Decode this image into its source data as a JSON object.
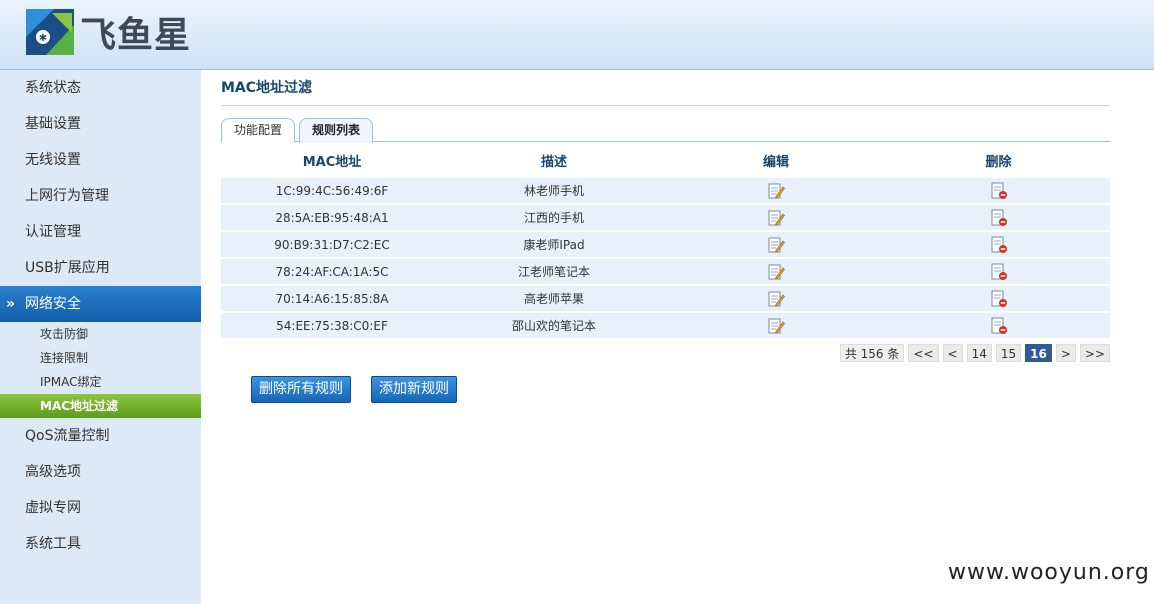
{
  "logo": {
    "text": "飞鱼星"
  },
  "sidebar": {
    "items": [
      {
        "label": "系统状态"
      },
      {
        "label": "基础设置"
      },
      {
        "label": "无线设置"
      },
      {
        "label": "上网行为管理"
      },
      {
        "label": "认证管理"
      },
      {
        "label": "USB扩展应用"
      },
      {
        "label": "网络安全",
        "expanded": true
      },
      {
        "label": "QoS流量控制"
      },
      {
        "label": "高级选项"
      },
      {
        "label": "虚拟专网"
      },
      {
        "label": "系统工具"
      }
    ],
    "subitems": [
      {
        "label": "攻击防御"
      },
      {
        "label": "连接限制"
      },
      {
        "label": "IPMAC绑定"
      },
      {
        "label": "MAC地址过滤",
        "selected": true
      }
    ]
  },
  "main": {
    "title": "MAC地址过滤",
    "tabs": [
      {
        "label": "功能配置"
      },
      {
        "label": "规则列表",
        "active": true
      }
    ],
    "table": {
      "headers": [
        "MAC地址",
        "描述",
        "编辑",
        "删除"
      ],
      "rows": [
        {
          "mac": "1C:99:4C:56:49:6F",
          "desc": "林老师手机"
        },
        {
          "mac": "28:5A:EB:95:48:A1",
          "desc": "江西的手机"
        },
        {
          "mac": "90:B9:31:D7:C2:EC",
          "desc": "康老师IPad"
        },
        {
          "mac": "78:24:AF:CA:1A:5C",
          "desc": "江老师笔记本"
        },
        {
          "mac": "70:14:A6:15:85:8A",
          "desc": "高老师苹果"
        },
        {
          "mac": "54:EE:75:38:C0:EF",
          "desc": "邵山欢的笔记本"
        }
      ],
      "edit_icon": "edit-icon",
      "delete_icon": "delete-icon"
    },
    "pager": {
      "total": "共 156 条",
      "first": "<<",
      "prev": "<",
      "pages": [
        "14",
        "15",
        "16"
      ],
      "current": "16",
      "next": ">",
      "last": ">>"
    },
    "buttons": {
      "delete_all": "删除所有规则",
      "add_new": "添加新规则"
    }
  },
  "watermark": "www.wooyun.org",
  "colors": {
    "accent": "#135fa8",
    "selected": "#6aaa24",
    "row_bg": "#e6f1fb",
    "sidebar_bg": "#dce9f6"
  }
}
